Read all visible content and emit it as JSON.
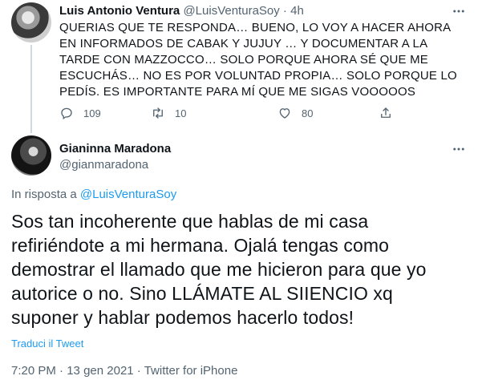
{
  "parent_tweet": {
    "name": "Luis Antonio Ventura",
    "handle": "@LuisVenturaSoy",
    "separator": " · ",
    "time": "4h",
    "text": "QUERIAS QUE TE RESPONDA… BUENO, LO VOY A HACER AHORA EN INFORMADOS DE CABAK Y JUJUY … Y DOCUMENTAR A LA TARDE CON MAZZOCCO… SOLO PORQUE AHORA SÉ QUE ME ESCUCHÁS… NO ES POR VOLUNTAD PROPIA… SOLO PORQUE LO PEDÍS. ES IMPORTANTE PARA MÍ QUE ME SIGAS VOOOOOS",
    "actions": {
      "replies": "109",
      "retweets": "10",
      "likes": "80"
    },
    "icons": [
      "reply-icon",
      "retweet-icon",
      "like-icon",
      "share-icon",
      "more-icon"
    ]
  },
  "main_tweet": {
    "name": "Gianinna Maradona",
    "handle": "@gianmaradona",
    "reply_prefix": "In risposta a ",
    "reply_to": "@LuisVenturaSoy",
    "text": "Sos tan incoherente que hablas de mi casa refiriéndote a mi hermana. Ojalá tengas como demostrar el llamado que me hicieron para que yo autorice o no. Sino LLÁMATE AL SIIENCIO xq suponer y hablar podemos hacerlo todos!",
    "translate_label": "Traduci il Tweet",
    "time": "7:20 PM",
    "date": "13 gen 2021",
    "source": "Twitter for iPhone",
    "separator": " · "
  },
  "colors": {
    "accent": "#1d9bf0",
    "text": "#0f1419",
    "muted": "#536471",
    "thread_line": "#cfd9de"
  }
}
